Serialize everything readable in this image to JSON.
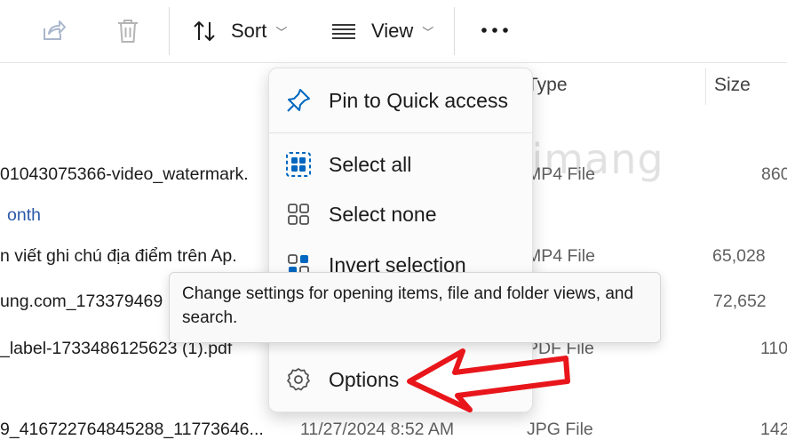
{
  "toolbar": {
    "sort_label": "Sort",
    "view_label": "View"
  },
  "columns": {
    "type": "Type",
    "size": "Size"
  },
  "rows": [
    {
      "name": "01043075366-video_watermark.",
      "type": "MP4 File",
      "size": "860"
    },
    {
      "name": "n viết ghi chú địa điểm trên Ap.",
      "type": "MP4 File",
      "size": "65,028"
    },
    {
      "name": "ung.com_173379469",
      "type": "",
      "size": "72,652"
    },
    {
      "name": "_label-1733486125623 (1).pdf",
      "type": "PDF File",
      "size": "110"
    },
    {
      "name": "9_416722764845288_11773646...",
      "date": "11/27/2024 8:52 AM",
      "type": "JPG File",
      "size": "142"
    }
  ],
  "group_header": "onth",
  "menu": {
    "pin_label": "Pin to Quick access",
    "select_all_label": "Select all",
    "select_none_label": "Select none",
    "invert_label": "Invert selection",
    "options_label": "Options"
  },
  "tooltip": "Change settings for opening items, file and folder views, and search.",
  "colors": {
    "accent": "#0067c0",
    "arrow": "#e8161b",
    "group_link": "#2b5aa8"
  }
}
